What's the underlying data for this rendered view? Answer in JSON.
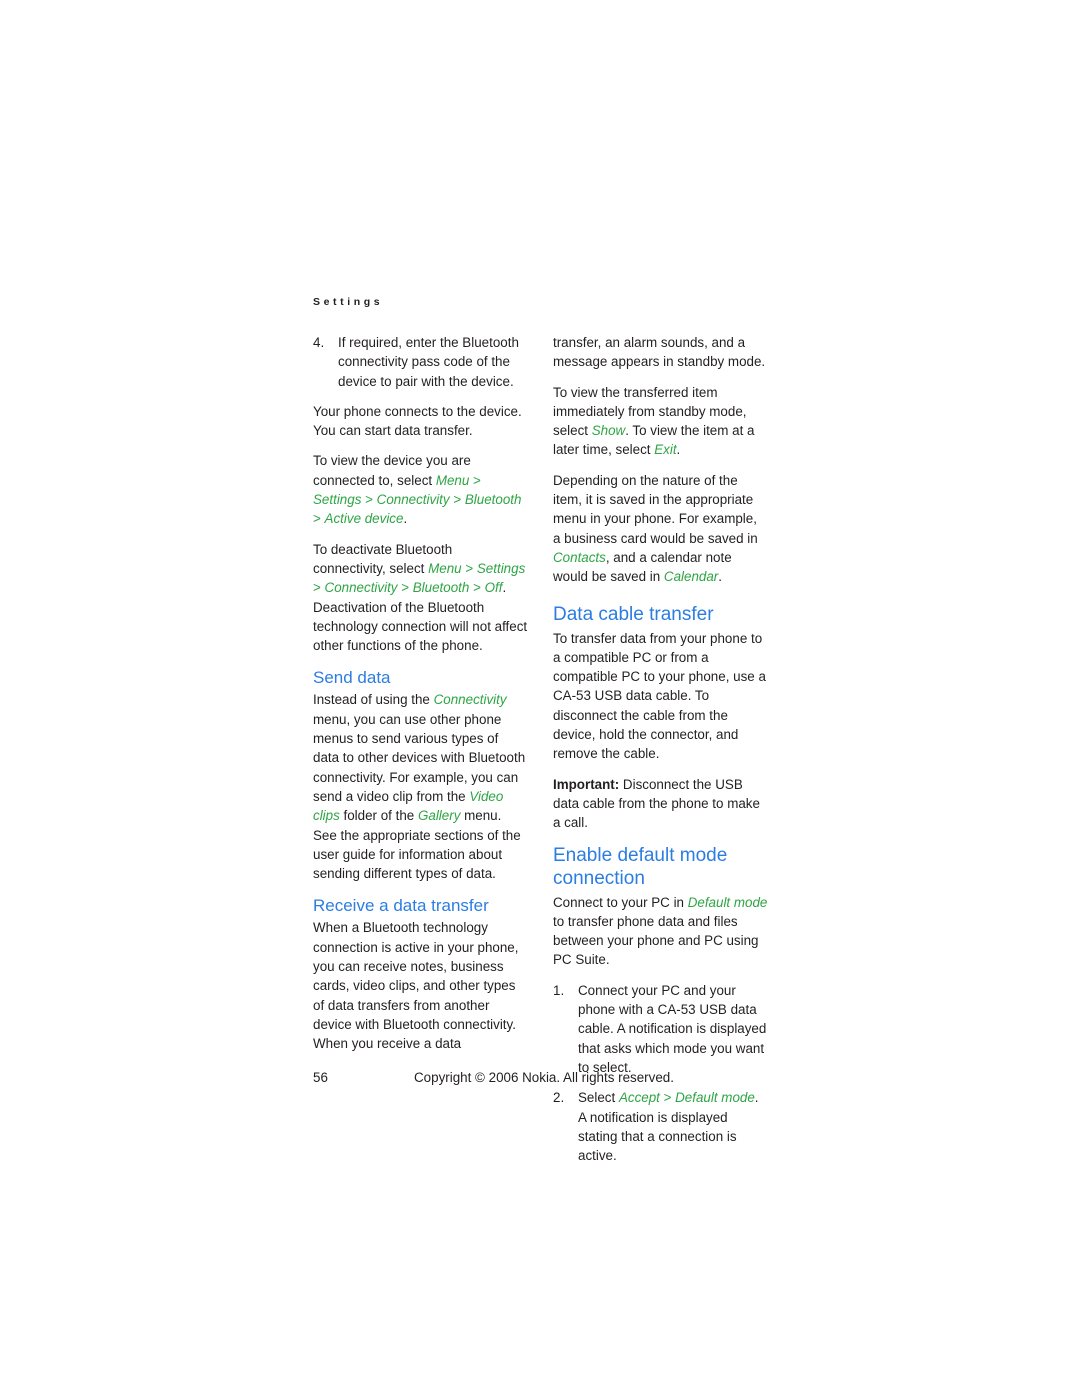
{
  "header": {
    "running_head": "Settings"
  },
  "left_column": {
    "step4": {
      "marker": "4.",
      "text": "If required, enter the Bluetooth connectivity pass code of the device to pair with the device."
    },
    "para_connects": "Your phone connects to the device. You can start data transfer.",
    "para_view_device": {
      "t1": "To view the device you are connected to, select ",
      "ui1": "Menu",
      "gt1": " > ",
      "ui2": "Settings",
      "gt2": " > ",
      "ui3": "Connectivity",
      "gt3": " > ",
      "ui4": "Bluetooth",
      "gt4": " > ",
      "ui5": "Active device",
      "t2": "."
    },
    "para_deactivate": {
      "t1": "To deactivate Bluetooth connectivity, select ",
      "ui1": "Menu",
      "gt1": " > ",
      "ui2": "Settings",
      "gt2": " > ",
      "ui3": "Connectivity",
      "gt3": " > ",
      "ui4": "Bluetooth",
      "gt4": " > ",
      "ui5": "Off",
      "t2": ". Deactivation of the Bluetooth technology connection will not affect other functions of the phone."
    },
    "send_data_heading": "Send data",
    "para_send_data": {
      "t1": "Instead of using the ",
      "ui1": "Connectivity",
      "t2": " menu, you can use other phone menus to send various types of data to other devices with Bluetooth connectivity. For example, you can send a video clip from the ",
      "ui2": "Video clips",
      "t3": " folder of the ",
      "ui3": "Gallery",
      "t4": " menu. See the appropriate sections of the user guide for information about sending different types of data."
    },
    "receive_heading": "Receive a data transfer",
    "para_receive": "When a Bluetooth technology connection is active in your phone, you can receive notes, business cards, video clips, and other types of data transfers from another device with Bluetooth connectivity. When you receive a data"
  },
  "right_column": {
    "para_continued": "transfer, an alarm sounds, and a message appears in standby mode.",
    "para_view_item": {
      "t1": "To view the transferred item immediately from standby mode, select ",
      "ui1": "Show",
      "t2": ". To view the item at a later time, select ",
      "ui2": "Exit",
      "t3": "."
    },
    "para_depending": {
      "t1": "Depending on the nature of the item, it is saved in the appropriate menu in your phone. For example, a business card would be saved in ",
      "ui1": "Contacts",
      "t2": ", and a calendar note would be saved in ",
      "ui2": "Calendar",
      "t3": "."
    },
    "data_cable_heading": "Data cable transfer",
    "para_data_cable": "To transfer data from your phone to a compatible PC or from a compatible PC to your phone, use a CA-53 USB data cable. To disconnect the cable from the device, hold the connector, and remove the cable.",
    "para_important": {
      "label": "Important:",
      "text": " Disconnect the USB data cable from the phone to make a call."
    },
    "enable_default_heading": "Enable default mode connection",
    "para_connect_pc": {
      "t1": "Connect to your PC in ",
      "ui1": "Default mode",
      "t2": " to transfer phone data and files between your phone and PC using PC Suite."
    },
    "step1": {
      "marker": "1.",
      "text": "Connect your PC and your phone with a CA-53 USB data cable. A notification is displayed that asks which mode you want to select."
    },
    "step2": {
      "marker": "2.",
      "t1": "Select ",
      "ui1": "Accept",
      "gt1": " > ",
      "ui2": "Default mode",
      "t2": ". A notification is displayed stating that a connection is active."
    }
  },
  "footer": {
    "page_number": "56",
    "copyright": "Copyright © 2006 Nokia. All rights reserved."
  },
  "colors": {
    "heading_blue": "#2b7de2",
    "ui_green": "#2ea544",
    "body_text": "#231f20",
    "page_background": "#ffffff"
  }
}
